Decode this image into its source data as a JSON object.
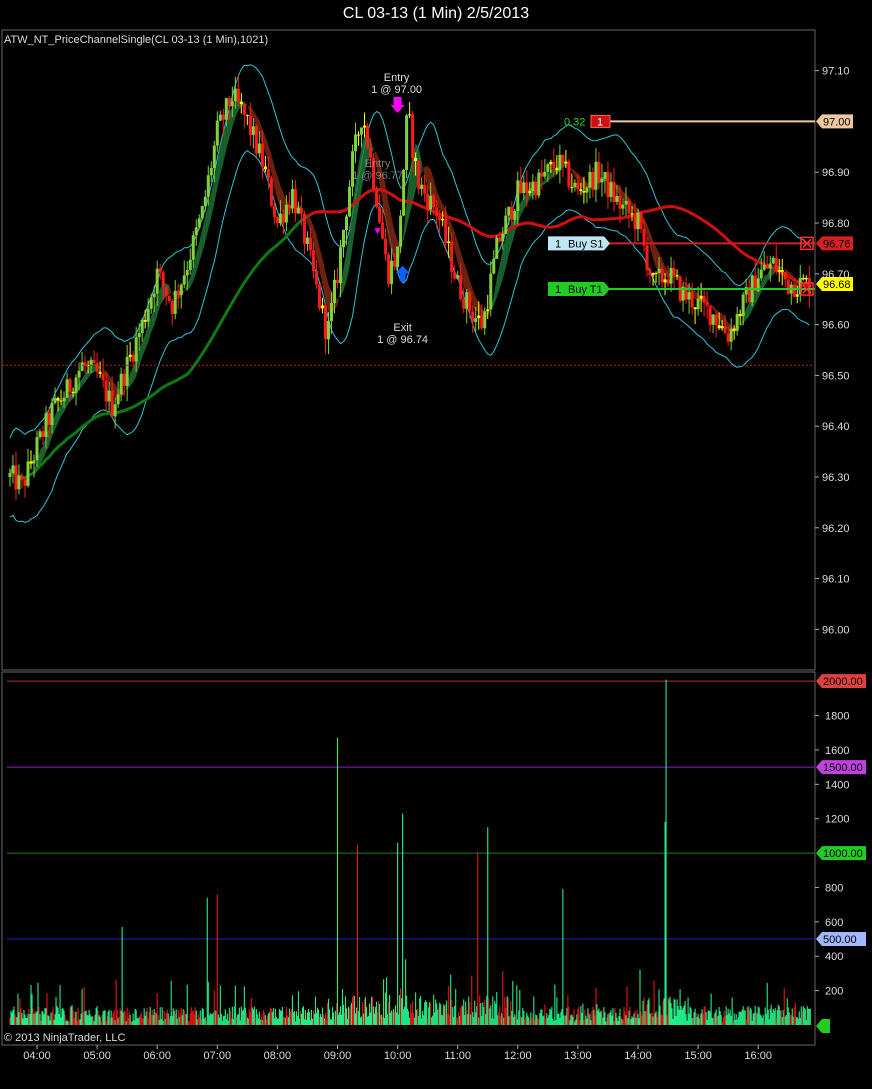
{
  "window": {
    "title": "CL 03-13 (1 Min)  2/5/2013"
  },
  "indicator_label": "ATW_NT_PriceChannelSingle(CL 03-13 (1 Min),1021)",
  "copyright": "© 2013 NinjaTrader, LLC",
  "colors": {
    "background": "#000000",
    "up_bar": "#7fd23c",
    "down_bar": "#ff1a1a",
    "doji_bar": "#ffff00",
    "channel_band": "#2ec4d6",
    "slow_ma": "#0f7a0f",
    "red_ma": "#d01010",
    "volume_up": "#22ee88",
    "volume_down": "#ee1111",
    "stop_line": "#d42020",
    "target_line": "#22cc22",
    "entry_line": "#f0c8a0"
  },
  "chart_data": [
    {
      "type": "candlestick",
      "panel": "price",
      "instrument": "CL 03-13",
      "interval": "1 Min",
      "date": "2/5/2013",
      "ylim": [
        95.92,
        97.18
      ],
      "yticks": [
        "97.10",
        "96.90",
        "96.80",
        "96.70",
        "96.60",
        "96.50",
        "96.40",
        "96.30",
        "96.20",
        "96.10",
        "96.00"
      ],
      "xticks": [
        "04:00",
        "05:00",
        "06:00",
        "07:00",
        "08:00",
        "09:00",
        "10:00",
        "11:00",
        "12:00",
        "13:00",
        "14:00",
        "15:00",
        "16:00"
      ],
      "price_path_approx": {
        "x": [
          "03:35",
          "03:45",
          "04:00",
          "04:15",
          "04:30",
          "04:45",
          "05:00",
          "05:15",
          "05:30",
          "05:45",
          "06:00",
          "06:15",
          "06:30",
          "06:45",
          "07:00",
          "07:15",
          "07:30",
          "07:45",
          "08:00",
          "08:15",
          "08:30",
          "08:40",
          "08:50",
          "09:00",
          "09:15",
          "09:25",
          "09:40",
          "09:50",
          "10:00",
          "10:10",
          "10:20",
          "10:40",
          "11:00",
          "11:15",
          "11:25",
          "11:40",
          "12:00",
          "12:20",
          "12:40",
          "13:00",
          "13:20",
          "13:40",
          "14:00",
          "14:15",
          "14:30",
          "14:45",
          "15:00",
          "15:15",
          "15:30",
          "15:45",
          "16:00",
          "16:15",
          "16:30",
          "16:45"
        ],
        "y": [
          96.3,
          96.28,
          96.36,
          96.43,
          96.47,
          96.52,
          96.5,
          96.44,
          96.52,
          96.6,
          96.7,
          96.64,
          96.72,
          96.82,
          96.98,
          97.05,
          97.0,
          96.92,
          96.8,
          96.86,
          96.75,
          96.66,
          96.58,
          96.7,
          96.92,
          97.02,
          96.84,
          96.7,
          96.74,
          97.02,
          96.88,
          96.82,
          96.68,
          96.62,
          96.6,
          96.76,
          96.86,
          96.88,
          96.92,
          96.86,
          96.9,
          96.84,
          96.8,
          96.68,
          96.7,
          96.66,
          96.64,
          96.62,
          96.58,
          96.64,
          96.7,
          96.72,
          96.68,
          96.68
        ]
      },
      "series": [
        {
          "name": "Stop S1 line",
          "y": 96.76
        },
        {
          "name": "Target T1 line",
          "y": 96.67
        },
        {
          "name": "Entry price line",
          "y": 97.0
        },
        {
          "name": "Reference line",
          "y": 96.52
        }
      ],
      "markers": [
        {
          "kind": "entry",
          "label": "Entry",
          "detail": "1 @ 97.00",
          "x": "10:00",
          "y": 97.0
        },
        {
          "kind": "exit",
          "label": "Exit",
          "detail": "1 @ 96.74",
          "x": "10:05",
          "y": 96.74
        },
        {
          "kind": "entry_faded",
          "label": "Entry",
          "detail": "1 @ 96.77",
          "x": "09:40",
          "y": 96.77
        }
      ],
      "price_tags": [
        {
          "text": "97.00",
          "y": 97.0,
          "color": "#f0c8a0"
        },
        {
          "text": "96.76",
          "y": 96.76,
          "color": "#d42020"
        },
        {
          "text": "96.68",
          "y": 96.68,
          "color": "#ffff00"
        }
      ],
      "order_labels": {
        "pnl": "0.32",
        "qty_box": "1",
        "stop": {
          "qty": "1",
          "text": "Buy S1"
        },
        "target": {
          "qty": "1",
          "text": "Buy T1"
        }
      }
    },
    {
      "type": "bar",
      "panel": "volume",
      "ylim": [
        0,
        2030
      ],
      "yticks": [
        "1800",
        "1600",
        "1400",
        "1200",
        "800",
        "600",
        "400",
        "200"
      ],
      "series": [
        {
          "name": "Level 2000",
          "y": 2000,
          "label": "2000.00",
          "color": "#c03030"
        },
        {
          "name": "Level 1500",
          "y": 1500,
          "label": "1500.00",
          "color": "#9020c0"
        },
        {
          "name": "Level 1000",
          "y": 1000,
          "label": "1000.00",
          "color": "#208020"
        },
        {
          "name": "Level 500",
          "y": 500,
          "label": "500.00",
          "color": "#2020c0"
        }
      ],
      "last_value_tag": "",
      "spikes": [
        {
          "x": "09:00",
          "value": 1670
        },
        {
          "x": "09:20",
          "value": 1050
        },
        {
          "x": "10:05",
          "value": 1230
        },
        {
          "x": "10:00",
          "value": 1060
        },
        {
          "x": "11:30",
          "value": 1150
        },
        {
          "x": "11:20",
          "value": 1000
        },
        {
          "x": "14:28",
          "value": 2010
        },
        {
          "x": "14:27",
          "value": 1180
        },
        {
          "x": "07:00",
          "value": 760
        },
        {
          "x": "06:50",
          "value": 740
        },
        {
          "x": "05:25",
          "value": 570
        },
        {
          "x": "12:45",
          "value": 790
        }
      ]
    }
  ]
}
